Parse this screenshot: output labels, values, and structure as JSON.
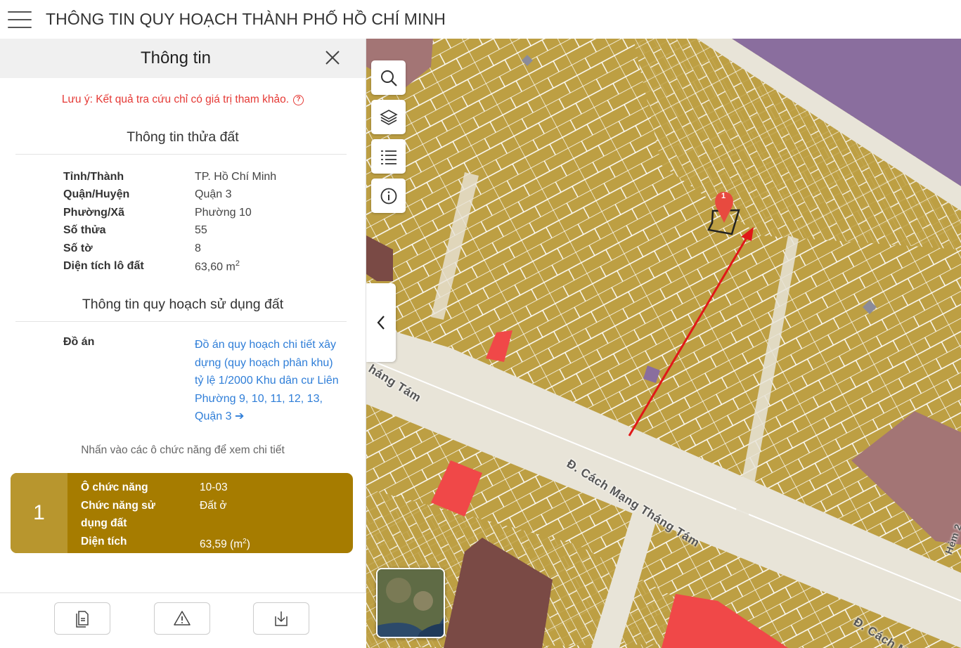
{
  "header": {
    "title": "THÔNG TIN QUY HOẠCH THÀNH PHỐ HỒ CHÍ MINH"
  },
  "panel": {
    "title": "Thông tin",
    "note": "Lưu ý: Kết quả tra cứu chỉ có giá trị tham khảo.",
    "parcel_section_title": "Thông tin thửa đất",
    "parcel": [
      {
        "label": "Tỉnh/Thành",
        "value": "TP. Hồ Chí Minh"
      },
      {
        "label": "Quận/Huyện",
        "value": "Quận 3"
      },
      {
        "label": "Phường/Xã",
        "value": "Phường 10"
      },
      {
        "label": "Số thửa",
        "value": "55"
      },
      {
        "label": "Số tờ",
        "value": "8"
      },
      {
        "label": "Diện tích lô đất",
        "value": "63,60 m",
        "unit_sup": "2"
      }
    ],
    "planning_section_title": "Thông tin quy hoạch sử dụng đất",
    "plan_label": "Đồ án",
    "plan_link": "Đồ án quy hoạch chi tiết xây dựng (quy hoạch phân khu) tỷ lệ 1/2000 Khu dân cư Liên Phường 9, 10, 11, 12, 13, Quận 3",
    "plan_arrow": "➔",
    "hint": "Nhấn vào các ô chức năng để xem chi tiết",
    "function_cell": {
      "number": "1",
      "rows": [
        {
          "label": "Ô chức năng",
          "value": "10-03"
        },
        {
          "label": "Chức năng sử dụng đất",
          "value": "Đất ở"
        },
        {
          "label": "Diện tích",
          "value": "63,59 (m",
          "sup": "2",
          "suffix": ")"
        }
      ],
      "color": "#a67c00"
    }
  },
  "map": {
    "marker_label": "1",
    "streets": [
      {
        "name": "Đ. Cách Mạng Tháng Tám"
      },
      {
        "name": "háng Tám"
      },
      {
        "name": "Đ. Cách M"
      },
      {
        "name": "Hẻm 2"
      }
    ],
    "colors": {
      "residential": "#bd9f43",
      "road": "#e8e4d8",
      "purple_zone": "#8a6e9e",
      "brown_zone": "#7a4a45",
      "red_zone": "#f04848",
      "mauve_zone": "#a37575"
    }
  },
  "icons": {
    "search": "search-icon",
    "layers": "layers-icon",
    "legend": "list-icon",
    "info": "info-icon",
    "collapse": "chevron-left-icon"
  }
}
